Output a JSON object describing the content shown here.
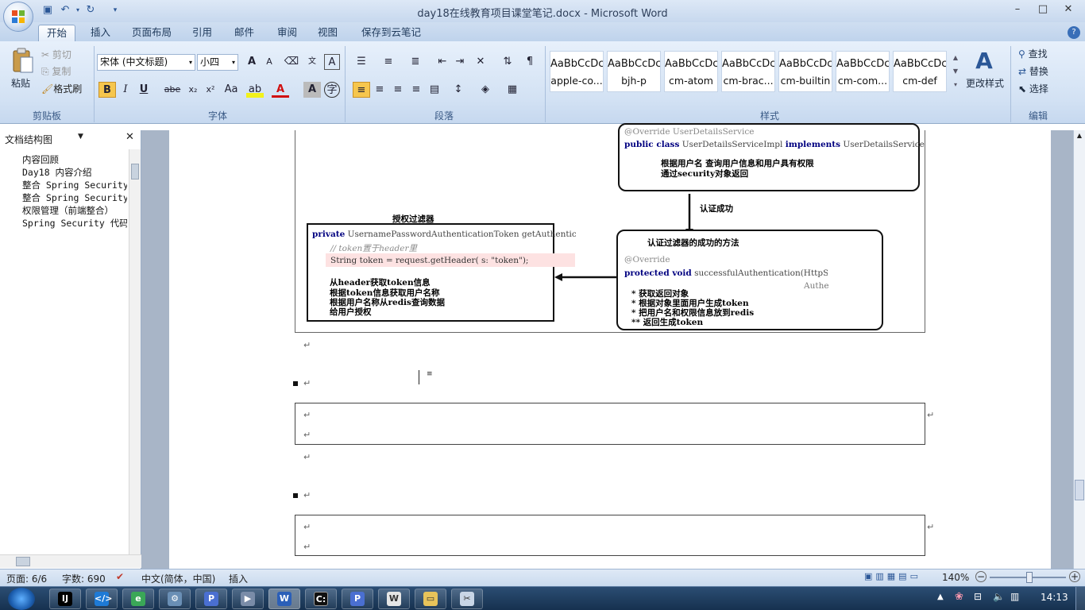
{
  "window": {
    "title": "day18在线教育项目课堂笔记.docx - Microsoft Word"
  },
  "tabs": [
    "开始",
    "插入",
    "页面布局",
    "引用",
    "邮件",
    "审阅",
    "视图",
    "保存到云笔记"
  ],
  "clipboard": {
    "paste": "粘贴",
    "cut": "剪切",
    "copy": "复制",
    "format_painter": "格式刷",
    "label": "剪贴板"
  },
  "font": {
    "name": "宋体 (中文标题)",
    "size": "小四",
    "label": "字体",
    "bold": "B",
    "italic": "I",
    "underline": "U",
    "strike": "abe",
    "sub": "x₂",
    "sup": "x²",
    "case": "Aa",
    "grow": "A",
    "shrink": "A",
    "char_a": "A"
  },
  "paragraph": {
    "label": "段落"
  },
  "styles": {
    "label": "样式",
    "sample": "AaBbCcDc",
    "items": [
      "apple-co...",
      "bjh-p",
      "cm-atom",
      "cm-brac...",
      "cm-builtin",
      "cm-com...",
      "cm-def"
    ],
    "change": "更改样式"
  },
  "editing": {
    "label": "编辑",
    "find": "查找",
    "replace": "替换",
    "select": "选择"
  },
  "docmap": {
    "title": "文档结构图",
    "items": [
      "内容回顾",
      "Day18 内容介绍",
      "整合 Spring Security 权",
      "整合 Spring Security 权",
      "权限管理（前端整合）",
      "Spring Security 代码执行"
    ]
  },
  "diagram": {
    "top_box": {
      "annotation": "@Override  UserDetailsService",
      "code_line": "public class UserDetailsServiceImpl implements UserDetailsService",
      "code_kw1": "public class",
      "code_cls": "UserDetailsServiceImpl",
      "code_kw2": "implements",
      "code_iface": "UserDetailsService",
      "note1": "根据用户名 查询用户信息和用户具有权限",
      "note2": "通过security对象返回"
    },
    "arrow_label": "认证成功",
    "left_title": "授权过滤器",
    "left_box": {
      "code1_kw": "private",
      "code1": "UsernamePasswordAuthenticationToken getAuthenticatio",
      "comment": "// token置于header里",
      "code2": "String token = request.getHeader( s: \"token\");",
      "notes": [
        "从header获取token信息",
        "根据token信息获取用户名称",
        "根据用户名称从redis查询数据",
        "给用户授权"
      ]
    },
    "right_box": {
      "title": "认证过滤器的成功的方法",
      "annotation": "@Override",
      "code_kw": "protected void",
      "code": "successfulAuthentication(HttpS",
      "code_tail": "Authe",
      "bullets": [
        "* 获取返回对象",
        "* 根据对象里面用户生成token",
        "* 把用户名和权限信息放到redis",
        "** 返回生成token"
      ]
    }
  },
  "para_mark": "↵",
  "status": {
    "page": "页面: 6/6",
    "words": "字数: 690",
    "lang": "中文(简体，中国)",
    "mode": "插入",
    "zoom": "140%"
  },
  "taskbar": {
    "time": "14:13",
    "apps": [
      "IntelliJ",
      "VS Code",
      "IE",
      "Tool",
      "PowerPoint",
      "Media",
      "Word",
      "Cmd",
      "PowerPoint 2",
      "Word 2",
      "Explorer",
      "Snip"
    ]
  },
  "colors": {
    "accent": "#2b5797",
    "taskbar": "#1e3a5c"
  }
}
